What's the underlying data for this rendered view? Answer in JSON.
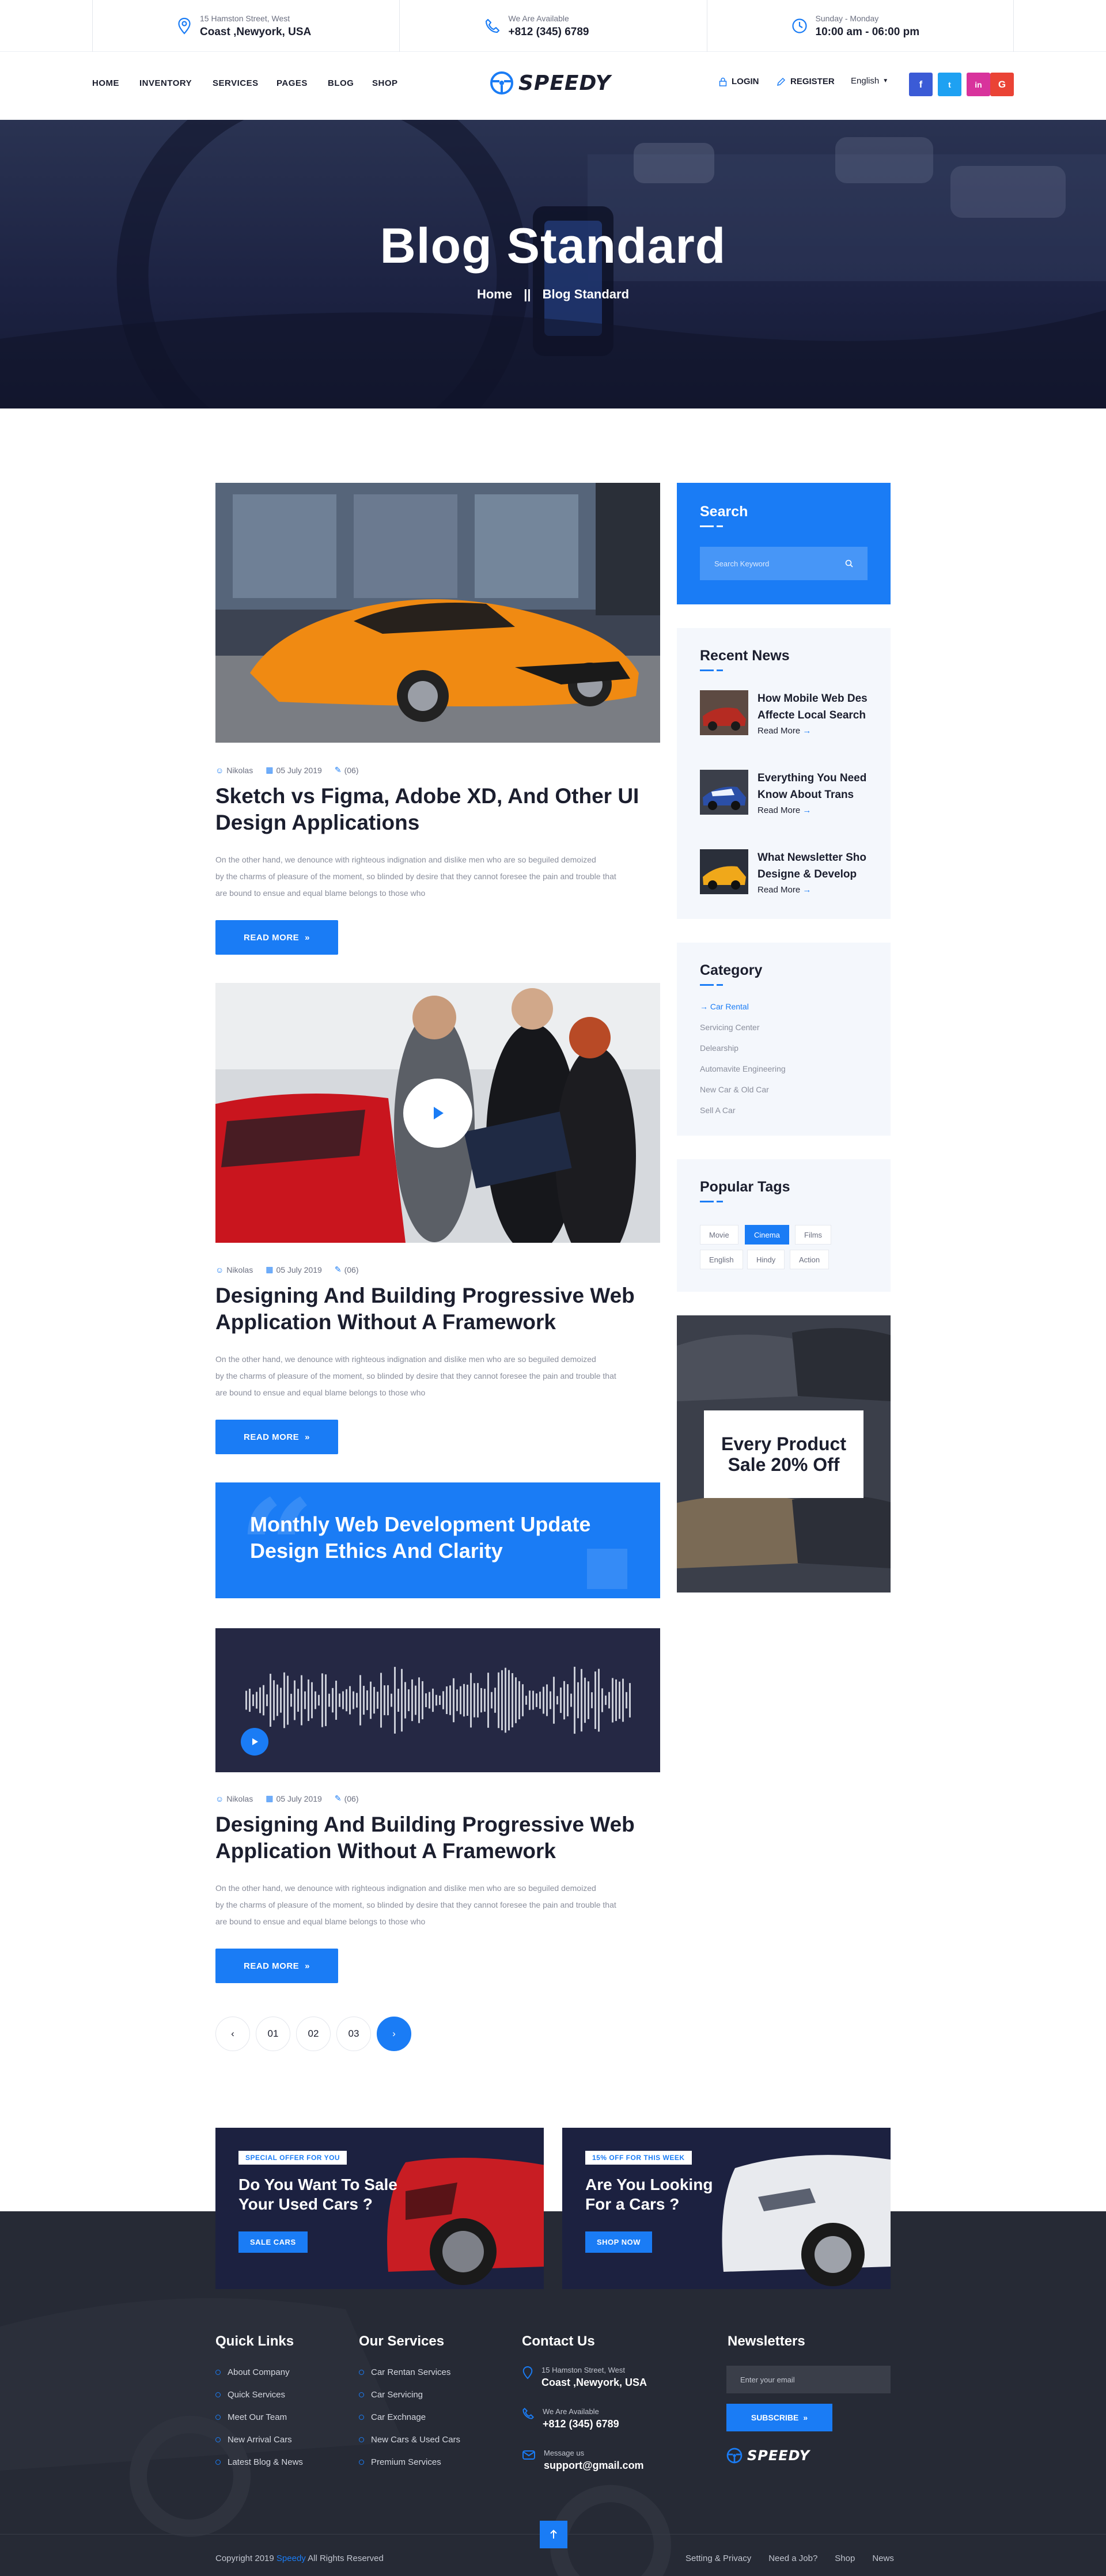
{
  "topbar": {
    "address": {
      "small": "15 Hamston Street, West",
      "big": "Coast ,Newyork, USA"
    },
    "phone": {
      "small": "We Are Available",
      "big": "+812 (345) 6789"
    },
    "hours": {
      "small": "Sunday - Monday",
      "big": "10:00 am - 06:00 pm"
    }
  },
  "nav": {
    "items": [
      "HOME",
      "INVENTORY",
      "SERVICES",
      "PAGES",
      "BLOG",
      "SHOP"
    ],
    "logo": "SPEEDY",
    "login": "LOGIN",
    "register": "REGISTER",
    "language": "English",
    "social": [
      "f",
      "t",
      "in",
      "G"
    ]
  },
  "hero": {
    "title": "Blog Standard",
    "crumb_home": "Home",
    "crumb_sep": "||",
    "crumb_current": "Blog Standard"
  },
  "posts": [
    {
      "author": "Nikolas",
      "date": "05 July 2019",
      "comments": "(06)",
      "title_l1": "Sketch vs Figma, Adobe XD, And Other UI",
      "title_l2": "Design Applications",
      "excerpt_l1": "On the other hand, we denounce with righteous indignation and dislike men who are so beguiled demoized",
      "excerpt_l2": "by the charms of pleasure of the moment, so blinded by desire that they cannot foresee the pain and trouble that",
      "excerpt_l3": "are bound to ensue and equal blame belongs to those who",
      "cta": "READ MORE"
    },
    {
      "author": "Nikolas",
      "date": "05 July 2019",
      "comments": "(06)",
      "title_l1": "Designing And Building Progressive Web",
      "title_l2": "Application Without A Framework",
      "excerpt_l1": "On the other hand, we denounce with righteous indignation and dislike men who are so beguiled demoized",
      "excerpt_l2": "by the charms of pleasure of the moment, so blinded by desire that they cannot foresee the pain and trouble that",
      "excerpt_l3": "are bound to ensue and equal blame belongs to those who",
      "cta": "READ MORE"
    },
    {
      "author": "Nikolas",
      "date": "05 July 2019",
      "comments": "(06)",
      "title_l1": "Designing And Building Progressive Web",
      "title_l2": "Application Without A Framework",
      "excerpt_l1": "On the other hand, we denounce with righteous indignation and dislike men who are so beguiled demoized",
      "excerpt_l2": "by the charms of pleasure of the moment, so blinded by desire that they cannot foresee the pain and trouble that",
      "excerpt_l3": "are bound to ensue and equal blame belongs to those who",
      "cta": "READ MORE"
    }
  ],
  "quote": {
    "line1": "Monthly Web Development Update",
    "line2": "Design Ethics And Clarity"
  },
  "pagination": [
    "01",
    "02",
    "03"
  ],
  "sidebar": {
    "search": {
      "title": "Search",
      "placeholder": "Search Keyword"
    },
    "recent": {
      "title": "Recent News",
      "items": [
        {
          "l1": "How Mobile Web Des",
          "l2": "Affecte Local Search",
          "rm": "Read More"
        },
        {
          "l1": "Everything You Need",
          "l2": "Know About Trans",
          "rm": "Read More"
        },
        {
          "l1": "What Newsletter Sho",
          "l2": "Designe & Develop",
          "rm": "Read More"
        }
      ]
    },
    "category": {
      "title": "Category",
      "items": [
        "Car Rental",
        "Servicing Center",
        "Delearship",
        "Automavite Engineering",
        "New Car & Old Car",
        "Sell A Car"
      ]
    },
    "tags": {
      "title": "Popular Tags",
      "items": [
        "Movie",
        "Cinema",
        "Films",
        "English",
        "Hindy",
        "Action"
      ]
    },
    "ad": {
      "l1": "Every Product",
      "l2": "Sale 20% Off"
    }
  },
  "promos": [
    {
      "badge": "SPECIAL OFFER FOR YOU",
      "l1": "Do You Want To Sale",
      "l2": "Your Used Cars ?",
      "cta": "SALE CARS"
    },
    {
      "badge": "15% OFF FOR THIS WEEK",
      "l1": "Are You Looking",
      "l2": "For a Cars ?",
      "cta": "SHOP NOW"
    }
  ],
  "footer": {
    "quick": {
      "title": "Quick Links",
      "items": [
        "About Company",
        "Quick Services",
        "Meet Our Team",
        "New Arrival Cars",
        "Latest Blog & News"
      ]
    },
    "services": {
      "title": "Our Services",
      "items": [
        "Car Rentan Services",
        "Car Servicing",
        "Car Exchnage",
        "New Cars & Used Cars",
        "Premium Services"
      ]
    },
    "contact": {
      "title": "Contact Us",
      "address": {
        "small": "15 Hamston Street, West",
        "big": "Coast ,Newyork, USA"
      },
      "phone": {
        "small": "We Are Available",
        "big": "+812 (345) 6789"
      },
      "mail": {
        "small": "Message us",
        "big": "support@gmail.com"
      }
    },
    "news": {
      "title": "Newsletters",
      "placeholder": "Enter your email",
      "cta": "SUBSCRIBE",
      "logo": "SPEEDY"
    },
    "copyright_pre": "Copyright  2019 ",
    "copyright_brand": "Speedy",
    "copyright_post": " All Rights Reserved",
    "links": [
      "Setting & Privacy",
      "Need a Job?",
      "Shop",
      "News"
    ]
  },
  "colors": {
    "accent": "#1a7cf5",
    "dark": "#1b1e2e",
    "footer": "#262a35"
  }
}
